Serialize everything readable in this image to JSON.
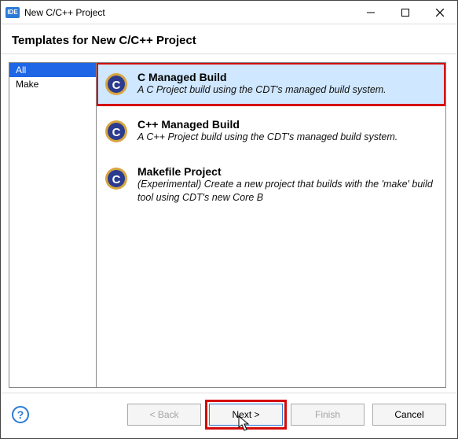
{
  "window": {
    "app_badge": "IDE",
    "title": "New C/C++ Project"
  },
  "header": {
    "title": "Templates for New C/C++ Project"
  },
  "categories": [
    {
      "label": "All",
      "selected": true
    },
    {
      "label": "Make",
      "selected": false
    }
  ],
  "templates": [
    {
      "title": "C Managed Build",
      "desc": "A C Project build using the CDT's managed build system.",
      "selected": true
    },
    {
      "title": "C++ Managed Build",
      "desc": "A C++ Project build using the CDT's managed build system.",
      "selected": false
    },
    {
      "title": "Makefile Project",
      "desc": "(Experimental) Create a new project that builds with the 'make' build tool using CDT's new Core B",
      "selected": false
    }
  ],
  "buttons": {
    "back": "< Back",
    "next": "Next >",
    "finish": "Finish",
    "cancel": "Cancel"
  },
  "help_glyph": "?"
}
